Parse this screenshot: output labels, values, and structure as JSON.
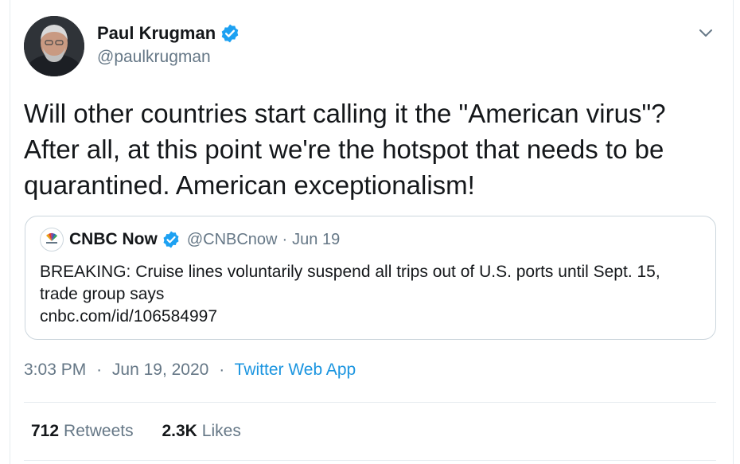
{
  "tweet": {
    "author": {
      "display_name": "Paul Krugman",
      "handle": "@paulkrugman",
      "verified": true
    },
    "text": "Will other countries start calling it the \"American virus\"? After all, at this point we're the hotspot that needs to be quarantined. American exceptionalism!",
    "time": "3:03 PM",
    "date": "Jun 19, 2020",
    "separator": "·",
    "source": "Twitter Web App",
    "stats": {
      "retweets_count": "712",
      "retweets_label": "Retweets",
      "likes_count": "2.3K",
      "likes_label": "Likes"
    }
  },
  "quoted_tweet": {
    "display_name": "CNBC Now",
    "handle": "@CNBCnow",
    "separator": "·",
    "date": "Jun 19",
    "verified": true,
    "text": "BREAKING: Cruise lines voluntarily suspend all trips out of U.S. ports until Sept. 15, trade group says",
    "link": "cnbc.com/id/106584997"
  },
  "colors": {
    "text": "#14171a",
    "secondary": "#657786",
    "link": "#1b95e0",
    "verified": "#1da1f2",
    "border": "#ccd6dd"
  }
}
